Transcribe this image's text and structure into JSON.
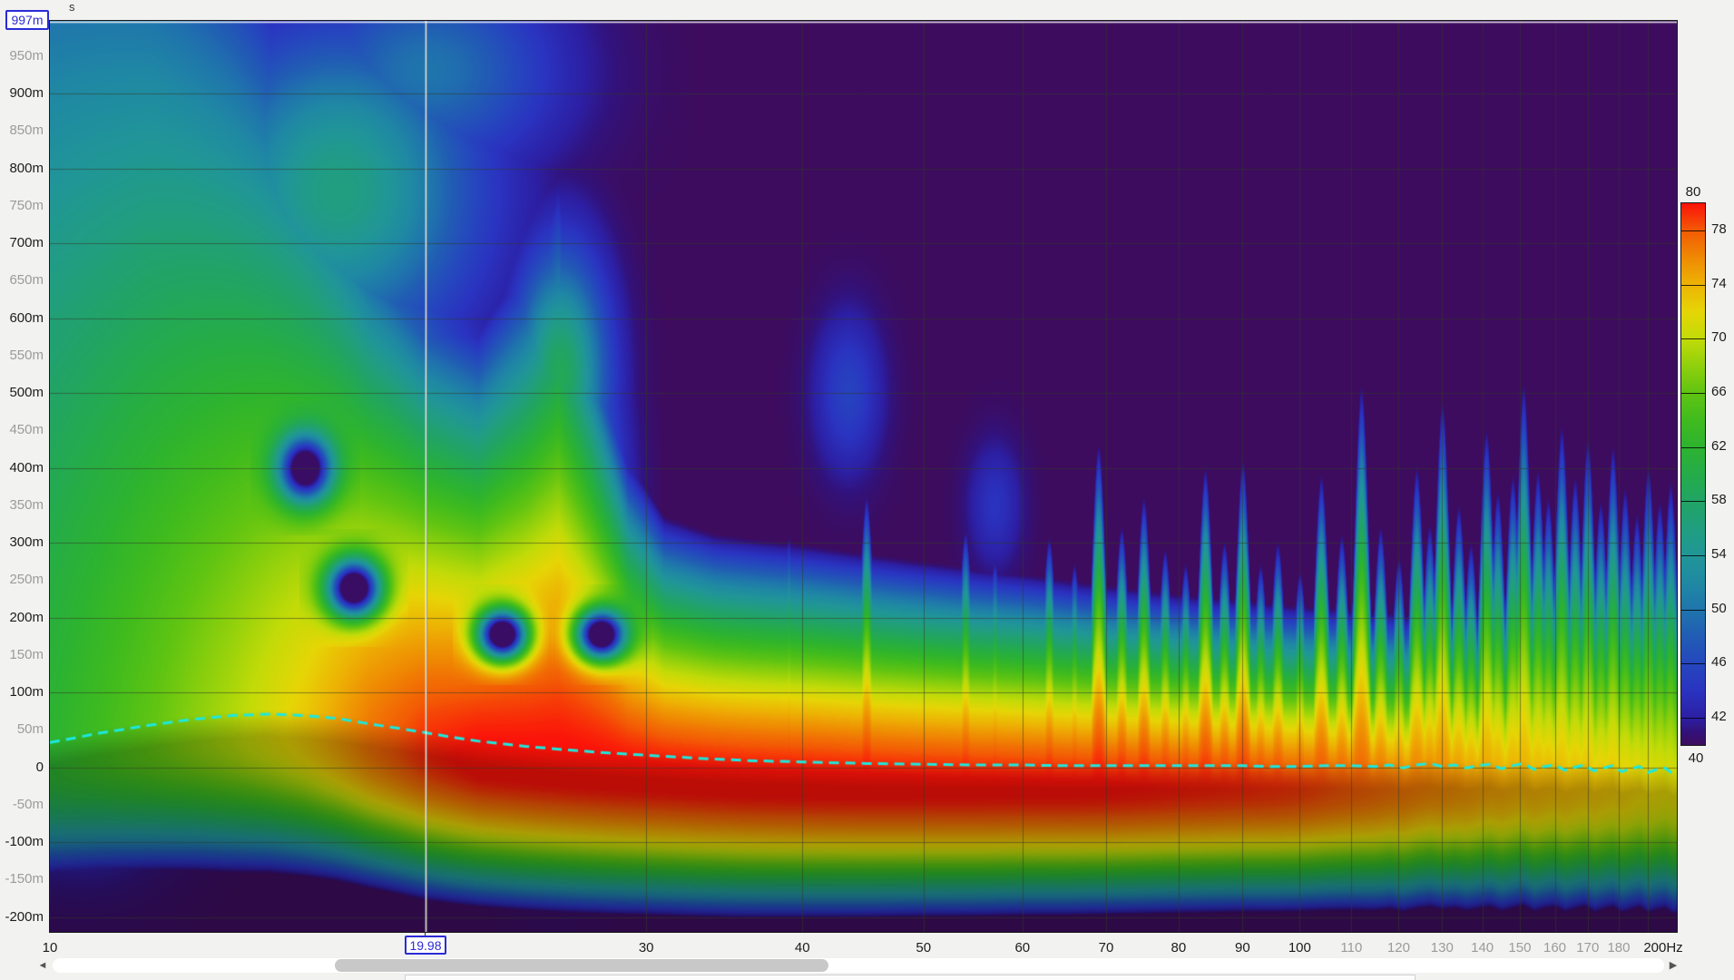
{
  "ui": {
    "y_axis_unit": "s",
    "cursor": {
      "time_label": "997m",
      "freq_label": "19.98"
    },
    "scrollbar": {
      "left_arrow": "◄",
      "right_arrow": "▶"
    }
  },
  "chart_data": {
    "type": "heatmap",
    "subtype": "wavelet-spectrogram",
    "title": "",
    "x_axis": {
      "scale": "log",
      "min_hz": 10,
      "max_hz": 200,
      "unit": "Hz",
      "ticks": [
        {
          "f": 10,
          "label": "10",
          "minor": false
        },
        {
          "f": 20,
          "label": "",
          "minor": false
        },
        {
          "f": 30,
          "label": "30",
          "minor": false
        },
        {
          "f": 40,
          "label": "40",
          "minor": false
        },
        {
          "f": 50,
          "label": "50",
          "minor": false
        },
        {
          "f": 60,
          "label": "60",
          "minor": false
        },
        {
          "f": 70,
          "label": "70",
          "minor": false
        },
        {
          "f": 80,
          "label": "80",
          "minor": false
        },
        {
          "f": 90,
          "label": "90",
          "minor": false
        },
        {
          "f": 100,
          "label": "100",
          "minor": false
        },
        {
          "f": 110,
          "label": "110",
          "minor": true
        },
        {
          "f": 120,
          "label": "120",
          "minor": true
        },
        {
          "f": 130,
          "label": "130",
          "minor": true
        },
        {
          "f": 140,
          "label": "140",
          "minor": true
        },
        {
          "f": 150,
          "label": "150",
          "minor": true
        },
        {
          "f": 160,
          "label": "160",
          "minor": true
        },
        {
          "f": 170,
          "label": "170",
          "minor": true
        },
        {
          "f": 180,
          "label": "180",
          "minor": true
        },
        {
          "f": 190,
          "label": "",
          "minor": true
        },
        {
          "f": 200,
          "label": "200Hz",
          "minor": false
        }
      ]
    },
    "y_axis": {
      "scale": "linear",
      "unit": "s",
      "top_ms": 997,
      "bottom_ms": -220,
      "tick_step_ms": 50,
      "major_step_ms": 100,
      "cursor_top_label": "997m"
    },
    "legend": {
      "min_db": 40,
      "max_db": 80,
      "top_label": "80",
      "bottom_label": "40",
      "tick_values": [
        78,
        74,
        70,
        66,
        62,
        58,
        54,
        50,
        46,
        42
      ],
      "colormap": [
        [
          40,
          "#3D0C5E"
        ],
        [
          41,
          "#32127A"
        ],
        [
          42,
          "#2C1FA4"
        ],
        [
          44,
          "#2A33C0"
        ],
        [
          46,
          "#2547BE"
        ],
        [
          48,
          "#215CB4"
        ],
        [
          50,
          "#1F75AC"
        ],
        [
          52,
          "#1F89A3"
        ],
        [
          54,
          "#209697"
        ],
        [
          56,
          "#219E7F"
        ],
        [
          58,
          "#21A464"
        ],
        [
          60,
          "#25AC49"
        ],
        [
          62,
          "#2DB330"
        ],
        [
          64,
          "#40BB1E"
        ],
        [
          66,
          "#60C412"
        ],
        [
          68,
          "#90D00C"
        ],
        [
          70,
          "#C2DB08"
        ],
        [
          72,
          "#E6D506"
        ],
        [
          74,
          "#EDB304"
        ],
        [
          76,
          "#EF8903"
        ],
        [
          78,
          "#F35A05"
        ],
        [
          80,
          "#FB1209"
        ]
      ]
    },
    "grid": {
      "shown": true,
      "vertical_every_hz": 10,
      "horizontal_every_ms": 100
    },
    "cursor": {
      "freq_hz": 19.98,
      "time_ms": 997
    },
    "overlay_line": {
      "name": "group-delay-line",
      "style": "dashed",
      "color": "#1DE8DE",
      "points_f_tms": [
        [
          10,
          33
        ],
        [
          11,
          46
        ],
        [
          12,
          56
        ],
        [
          13,
          64
        ],
        [
          14,
          69
        ],
        [
          15,
          71
        ],
        [
          16,
          69
        ],
        [
          17,
          65
        ],
        [
          18,
          58
        ],
        [
          19,
          52
        ],
        [
          20,
          46
        ],
        [
          21,
          40
        ],
        [
          22,
          35
        ],
        [
          24,
          28
        ],
        [
          26,
          23
        ],
        [
          28,
          19
        ],
        [
          30,
          16
        ],
        [
          33,
          12
        ],
        [
          36,
          9
        ],
        [
          40,
          7
        ],
        [
          45,
          5
        ],
        [
          50,
          4
        ],
        [
          55,
          3
        ],
        [
          60,
          3
        ],
        [
          65,
          2
        ],
        [
          70,
          2
        ],
        [
          75,
          2
        ],
        [
          80,
          2
        ],
        [
          85,
          2
        ],
        [
          90,
          2
        ],
        [
          95,
          1
        ],
        [
          100,
          1
        ],
        [
          105,
          2
        ],
        [
          110,
          2
        ],
        [
          115,
          1
        ],
        [
          118,
          3
        ],
        [
          121,
          -1
        ],
        [
          124,
          3
        ],
        [
          127,
          5
        ],
        [
          130,
          1
        ],
        [
          133,
          3
        ],
        [
          136,
          -1
        ],
        [
          139,
          2
        ],
        [
          142,
          4
        ],
        [
          145,
          -2
        ],
        [
          148,
          2
        ],
        [
          151,
          5
        ],
        [
          154,
          -3
        ],
        [
          157,
          1
        ],
        [
          160,
          3
        ],
        [
          163,
          -4
        ],
        [
          166,
          0
        ],
        [
          169,
          3
        ],
        [
          172,
          -5
        ],
        [
          175,
          -1
        ],
        [
          178,
          2
        ],
        [
          181,
          -6
        ],
        [
          184,
          -2
        ],
        [
          187,
          1
        ],
        [
          190,
          -7
        ],
        [
          193,
          -3
        ],
        [
          196,
          -1
        ],
        [
          199,
          -9
        ],
        [
          200,
          -8
        ]
      ]
    },
    "field_model": {
      "notes": "dB(f,t) model read off the plot: ridge level L0 by freq; decay extents up/down in ms; modal fingers (f, up-extent); gaussian blobs (f, t, sigma_u, sigma_t, dB); interference holes (f, t, sigma_u, sigma_t). Shading darkens below overlay line.",
      "ridge_db_by_f": [
        [
          10,
          62
        ],
        [
          12,
          66
        ],
        [
          14,
          69.5
        ],
        [
          16,
          73
        ],
        [
          18,
          77
        ],
        [
          20,
          79.5
        ],
        [
          22,
          80.5
        ],
        [
          40,
          80.5
        ],
        [
          70,
          80.2
        ],
        [
          90,
          79.5
        ],
        [
          100,
          79
        ],
        [
          110,
          78
        ],
        [
          120,
          77
        ],
        [
          130,
          76.2
        ],
        [
          140,
          75.2
        ],
        [
          150,
          74.5
        ],
        [
          160,
          74
        ],
        [
          170,
          73.5
        ],
        [
          180,
          73
        ],
        [
          190,
          72.2
        ],
        [
          200,
          71.5
        ]
      ],
      "decay_up_ms_by_f": [
        [
          10,
          1500
        ],
        [
          12,
          1350
        ],
        [
          14,
          1150
        ],
        [
          16,
          950
        ],
        [
          18,
          750
        ],
        [
          20,
          640
        ],
        [
          22,
          600
        ],
        [
          24,
          700
        ],
        [
          25.5,
          800
        ],
        [
          27,
          640
        ],
        [
          29,
          430
        ],
        [
          31,
          350
        ],
        [
          34,
          330
        ],
        [
          40,
          320
        ],
        [
          50,
          300
        ],
        [
          60,
          285
        ],
        [
          70,
          270
        ],
        [
          80,
          258
        ],
        [
          90,
          250
        ],
        [
          100,
          243
        ],
        [
          120,
          232
        ],
        [
          150,
          222
        ],
        [
          200,
          215
        ]
      ],
      "decay_down_ms_by_f": [
        [
          10,
          150
        ],
        [
          14,
          182
        ],
        [
          20,
          196
        ],
        [
          30,
          186
        ],
        [
          50,
          176
        ],
        [
          100,
          166
        ],
        [
          200,
          160
        ]
      ],
      "ridge_center_offset_ms": -28,
      "fingers_f_upms": [
        [
          33,
          300
        ],
        [
          36,
          260
        ],
        [
          39,
          330
        ],
        [
          42,
          290
        ],
        [
          45,
          390
        ],
        [
          48,
          300
        ],
        [
          51,
          265
        ],
        [
          54,
          345
        ],
        [
          57,
          305
        ],
        [
          60,
          285
        ],
        [
          63,
          335
        ],
        [
          66,
          300
        ],
        [
          69,
          460
        ],
        [
          72,
          350
        ],
        [
          75,
          390
        ],
        [
          78,
          320
        ],
        [
          81,
          300
        ],
        [
          84,
          430
        ],
        [
          87,
          330
        ],
        [
          90,
          440
        ],
        [
          93,
          300
        ],
        [
          96,
          330
        ],
        [
          100,
          290
        ],
        [
          104,
          420
        ],
        [
          108,
          340
        ],
        [
          112,
          540
        ],
        [
          116,
          350
        ],
        [
          120,
          310
        ],
        [
          124,
          430
        ],
        [
          127,
          350
        ],
        [
          130,
          520
        ],
        [
          134,
          380
        ],
        [
          137,
          330
        ],
        [
          141,
          480
        ],
        [
          144,
          400
        ],
        [
          148,
          420
        ],
        [
          151,
          540
        ],
        [
          155,
          430
        ],
        [
          158,
          390
        ],
        [
          162,
          490
        ],
        [
          166,
          420
        ],
        [
          170,
          470
        ],
        [
          174,
          390
        ],
        [
          178,
          460
        ],
        [
          182,
          410
        ],
        [
          186,
          370
        ],
        [
          190,
          440
        ],
        [
          194,
          390
        ],
        [
          198,
          420
        ]
      ],
      "finger_sigma_u": 0.0046,
      "blobs_f_t_su_st_db": [
        [
          16.5,
          420,
          0.055,
          170,
          63
        ],
        [
          17,
          770,
          0.06,
          150,
          56
        ],
        [
          20,
          930,
          0.055,
          95,
          50
        ],
        [
          25.3,
          330,
          0.022,
          180,
          67
        ],
        [
          25.6,
          520,
          0.02,
          115,
          59
        ],
        [
          12,
          610,
          0.028,
          115,
          50
        ],
        [
          10.3,
          295,
          0.022,
          90,
          53
        ],
        [
          10.6,
          120,
          0.04,
          115,
          62
        ],
        [
          43.5,
          500,
          0.015,
          75,
          45.5
        ],
        [
          57,
          350,
          0.012,
          60,
          44
        ]
      ],
      "holes_f_t_su_st": [
        [
          16.0,
          400,
          0.012,
          32
        ],
        [
          17.5,
          240,
          0.012,
          28
        ],
        [
          23.0,
          178,
          0.011,
          24
        ],
        [
          27.6,
          178,
          0.011,
          24
        ]
      ],
      "shade_below_line_factor": 0.74
    }
  }
}
